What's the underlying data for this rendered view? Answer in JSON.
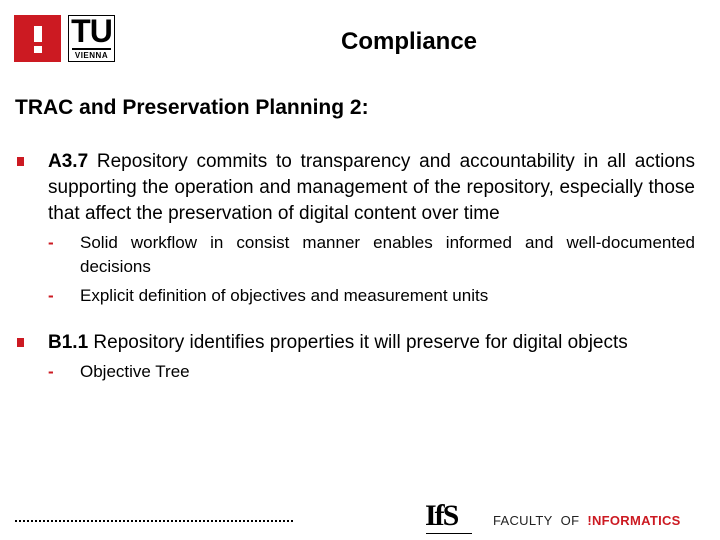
{
  "header": {
    "logo_exclamation": "!",
    "logo_tu": "TU",
    "logo_vienna": "VIENNA",
    "title": "Compliance"
  },
  "subtitle": "TRAC and Preservation Planning 2:",
  "bullets": [
    {
      "code": "A3.7",
      "text": " Repository commits to transparency and accountability in all actions supporting the operation and management of the repository, especially those that affect the preservation of digital content over time",
      "subitems": [
        "Solid workflow in consist manner enables informed and well-documented decisions",
        "Explicit definition of objectives and measurement units"
      ]
    },
    {
      "code": "B1.1",
      "text": " Repository identifies properties it will preserve for digital objects",
      "subitems": [
        "Objective Tree"
      ]
    }
  ],
  "footer": {
    "ifs_logo": "IfS",
    "faculty": "FACULTY",
    "of": "OF",
    "informatics": "!NFORMATICS"
  },
  "colors": {
    "accent": "#cc1a22",
    "text": "#000000"
  }
}
